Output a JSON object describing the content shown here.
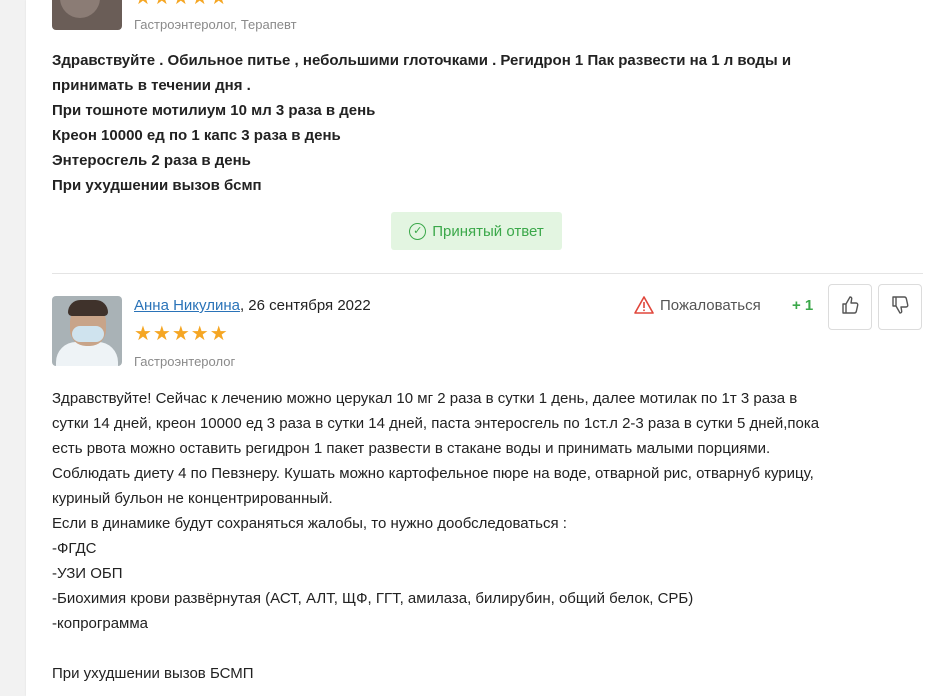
{
  "top_answer": {
    "specialty": "Гастроэнтеролог, Терапевт",
    "stars": "★★★★★",
    "lines": [
      "Здравствуйте . Обильное питье , небольшими глоточками . Регидрон 1 Пак развести на 1 л воды и",
      "принимать в течении дня .",
      "При тошноте мотилиум 10 мл 3 раза в день",
      "Креон 10000 ед по 1 капс 3 раза в день",
      "Энтеросгель 2 раза в день",
      "При ухудшении вызов бсмп"
    ],
    "accepted_label": "Принятый ответ"
  },
  "bottom_answer": {
    "author": "Анна Никулина",
    "date": ", 26 сентября 2022",
    "stars": "★★★★★",
    "specialty": "Гастроэнтеролог",
    "complain_label": "Пожаловаться",
    "score": "+ 1",
    "lines": [
      "Здравствуйте! Сейчас к лечению можно церукал 10 мг 2 раза в сутки 1 день, далее мотилак по 1т 3 раза в",
      "сутки 14 дней, креон 10000 ед 3 раза в сутки 14 дней, паста энтеросгель по 1ст.л 2-3 раза в сутки 5 дней,пока",
      "есть рвота можно оставить регидрон 1 пакет развести в стакане воды и принимать малыми порциями.",
      "Соблюдать диету 4 по Певзнеру. Кушать можно картофельное пюре на воде, отварной рис, отварнуб курицу,",
      "куриный бульон не концентрированный.",
      "Если в динамике будут сохраняться жалобы, то нужно дообследоваться :",
      "-ФГДС",
      "-УЗИ ОБП",
      "-Биохимия крови развёрнутая (АСТ, АЛТ, ЩФ, ГГТ, амилаза, билирубин, общий белок, СРБ)",
      "-копрограмма",
      "При ухудшении вызов БСМП"
    ]
  },
  "colors": {
    "accent_green": "#3ba84a",
    "link_blue": "#2a73b8",
    "star": "#f5a623"
  },
  "icons": [
    "check-circle-icon",
    "warning-icon",
    "thumbs-up-icon",
    "thumbs-down-icon"
  ]
}
